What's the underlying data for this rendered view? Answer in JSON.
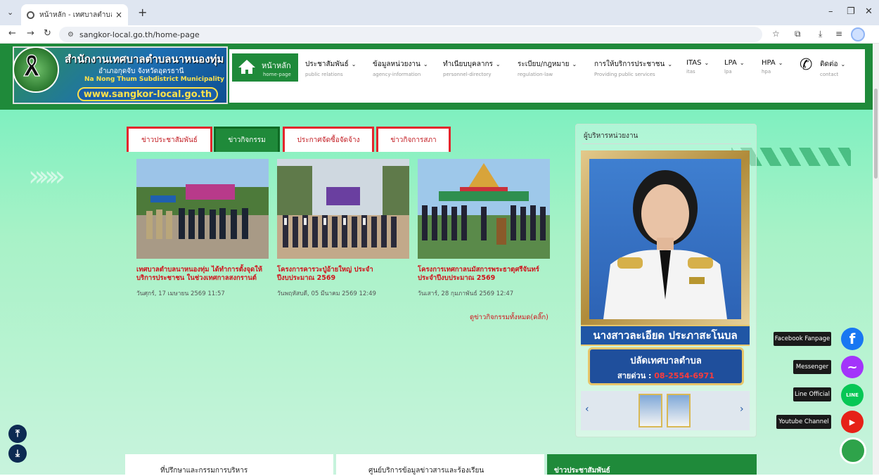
{
  "browser": {
    "tab_title": "หน้าหลัก - เทศบาลตำบลนาหนองทุ่ม อ.กุดจับ",
    "url": "sangkor-local.go.th/home-page"
  },
  "site": {
    "org_name": "สำนักงานเทศบาลตำบลนาหนองทุ่ม",
    "district": "อำเภอกุดจับ จังหวัดอุดรธานี",
    "english_name": "Na Nong Thum Subdistrict Municipality",
    "website": "www.sangkor-local.go.th"
  },
  "menu": {
    "home": {
      "label": "หน้าหลัก",
      "sub": "home-page"
    },
    "items": [
      {
        "label": "ประชาสัมพันธ์",
        "sub": "public relations"
      },
      {
        "label": "ข้อมูลหน่วยงาน",
        "sub": "agency-information"
      },
      {
        "label": "ทำเนียบบุคลากร",
        "sub": "personnel-directory"
      },
      {
        "label": "ระเบียบ/กฎหมาย",
        "sub": "regulation-law"
      },
      {
        "label": "การให้บริการประชาชน",
        "sub": "Providing public services"
      },
      {
        "label": "ITAS",
        "sub": "itas"
      },
      {
        "label": "LPA",
        "sub": "lpa"
      },
      {
        "label": "HPA",
        "sub": "hpa"
      },
      {
        "label": "ติดต่อ",
        "sub": "contact"
      }
    ]
  },
  "news": {
    "tabs": [
      "ข่าวประชาสัมพันธ์",
      "ข่าวกิจกรรม",
      "ประกาศจัดซื้อจัดจ้าง",
      "ข่าวกิจการสภา"
    ],
    "active_tab": "ข่าวกิจกรรม",
    "cards": [
      {
        "title": "เทศบาลตำบลนาหนองทุ่ม ได้ทำการตั้งจุดให้บริการประชาชน ในช่วงเทศกาลสงกรานต์",
        "date": "วันศุกร์, 17 เมษายน 2569 11:57"
      },
      {
        "title": "โครงการคารวะปู่อ้ายใหญ่ ประจำปีงบประมาณ 2569",
        "date": "วันพฤหัสบดี, 05 มีนาคม 2569 12:49"
      },
      {
        "title": "โครงการเทศกาลนมัสการพระธาตุศรีจันทร์ ประจำปีงบประมาณ 2569",
        "date": "วันเสาร์, 28 กุมภาพันธ์ 2569 12:47"
      }
    ],
    "see_all": "ดูข่าวกิจกรรมทั้งหมด(คลิ๊ก)"
  },
  "executive": {
    "heading": "ผู้บริหารหน่วยงาน",
    "name": "นางสาวละเอียด ประภาสะโนบล",
    "position": "ปลัดเทศบาลตำบล",
    "hotline_label": "สายด่วน :",
    "hotline_number": "08-2554-6971",
    "prev": "‹",
    "next": "›"
  },
  "social": [
    {
      "label": "Facebook Fanpage",
      "icon": "f",
      "color": "#1877f2"
    },
    {
      "label": "Messenger",
      "icon": "~",
      "color": "#a334fa"
    },
    {
      "label": "Line Official",
      "icon": "LINE",
      "color": "#06c755"
    },
    {
      "label": "Youtube Channel",
      "icon": "▶",
      "color": "#e62117"
    }
  ],
  "bottom": {
    "card1": "ที่ปรึกษาและกรรมการบริหาร",
    "card2": "ศูนย์บริการข้อมูลข่าวสารและร้องเรียน",
    "card3": "ข่าวประชาสัมพันธ์"
  }
}
